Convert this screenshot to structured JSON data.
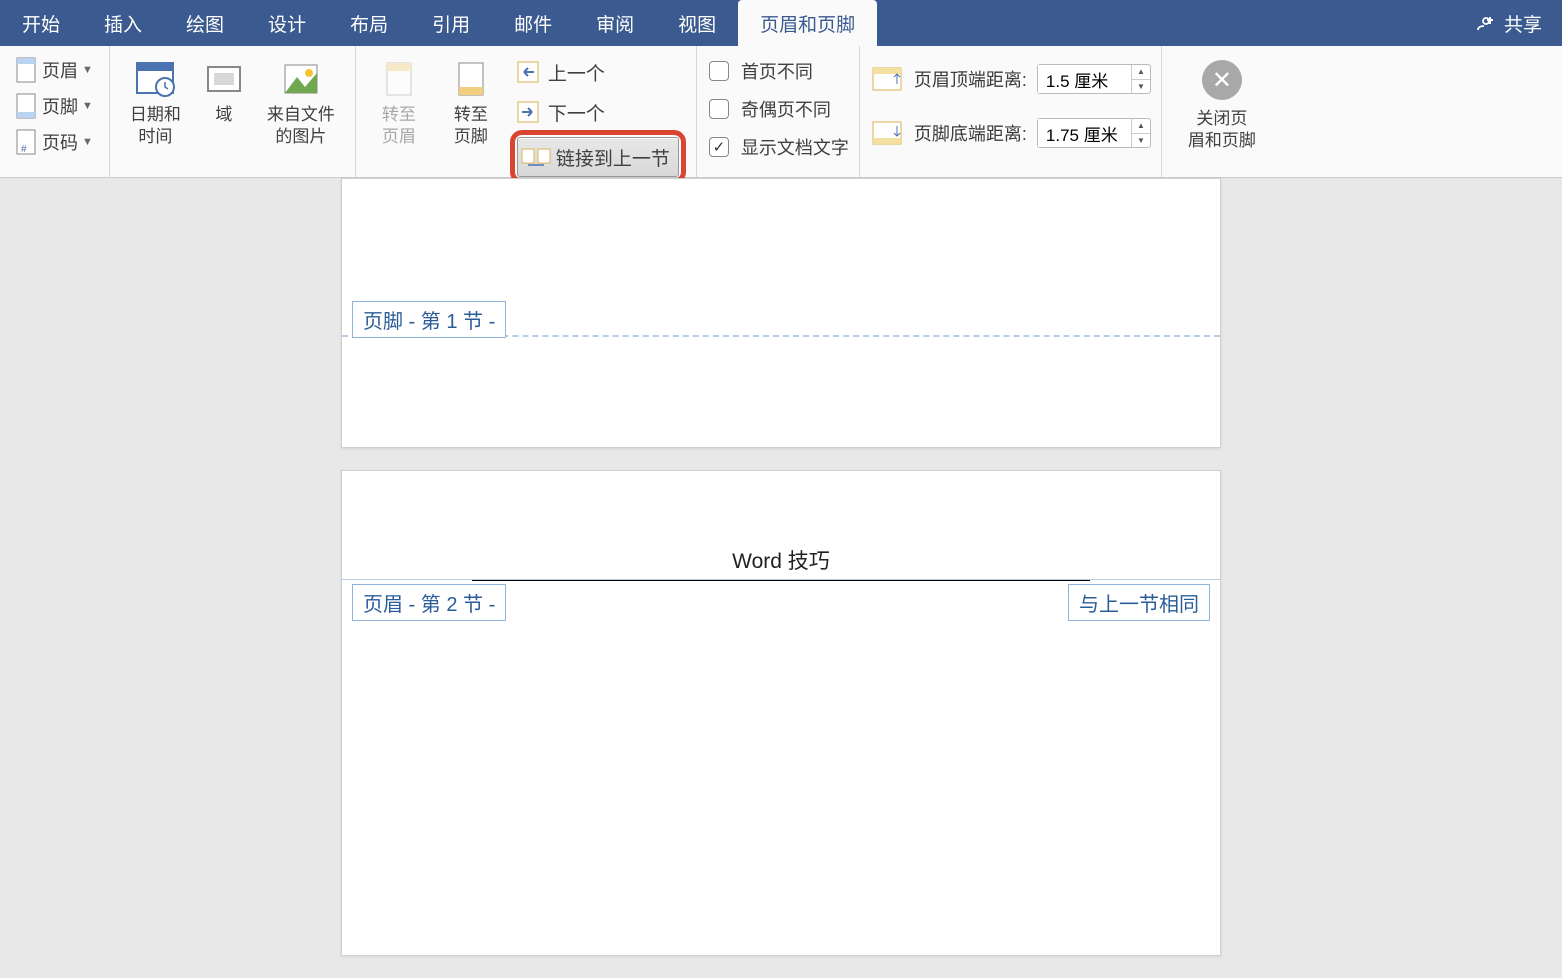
{
  "tabs": [
    "开始",
    "插入",
    "绘图",
    "设计",
    "布局",
    "引用",
    "邮件",
    "审阅",
    "视图",
    "页眉和页脚"
  ],
  "active_tab": "页眉和页脚",
  "share_label": "共享",
  "group1": {
    "header": "页眉",
    "footer": "页脚",
    "page_number": "页码"
  },
  "group2": {
    "datetime": "日期和\n时间",
    "field": "域",
    "picture": "来自文件\n的图片"
  },
  "group3": {
    "goto_header": "转至\n页眉",
    "goto_footer": "转至\n页脚",
    "previous": "上一个",
    "next": "下一个",
    "link_prev": "链接到上一节"
  },
  "group4": {
    "diff_first": "首页不同",
    "diff_odd_even": "奇偶页不同",
    "show_doc_text": "显示文档文字"
  },
  "group5": {
    "header_distance_label": "页眉顶端距离:",
    "header_distance_value": "1.5 厘米",
    "footer_distance_label": "页脚底端距离:",
    "footer_distance_value": "1.75 厘米"
  },
  "close_label": "关闭页\n眉和页脚",
  "doc": {
    "page1_footer_tag": "页脚 - 第 1 节 -",
    "page2_header_text": "Word 技巧",
    "page2_header_tag": "页眉 - 第 2 节 -",
    "page2_same_tag": "与上一节相同"
  }
}
